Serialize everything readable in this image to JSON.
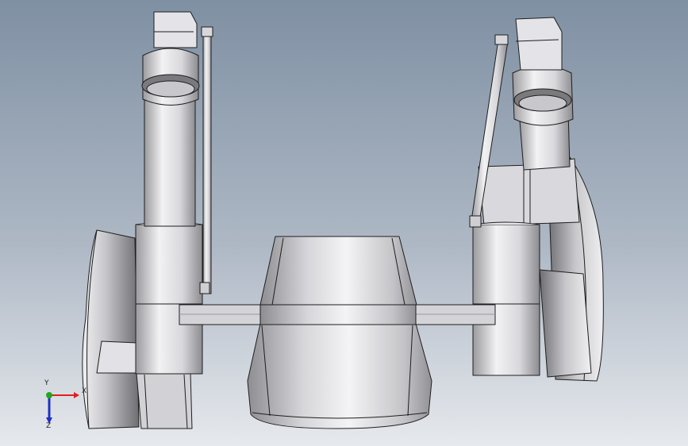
{
  "viewport": {
    "background_top": "#7f90a3",
    "background_bottom": "#e6e9ed"
  },
  "model": {
    "parts": [
      "left-robot-arm",
      "right-robot-arm",
      "ladle-body",
      "cross-beam"
    ],
    "part_color": "#dcdce0",
    "edge_color": "#222222"
  },
  "triad": {
    "x_label": "X",
    "y_label": "Y",
    "z_label": "Z",
    "x_color": "#e02020",
    "y_color": "#1fa81f",
    "z_color": "#2030c8"
  }
}
